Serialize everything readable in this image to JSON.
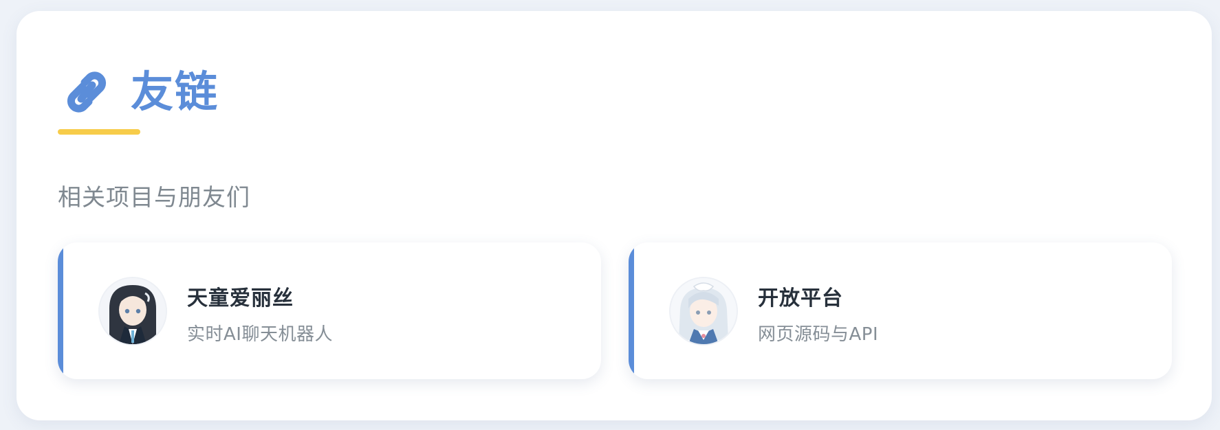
{
  "section": {
    "title": "友链",
    "title_icon": "link-icon",
    "subtitle": "相关项目与朋友们",
    "accent_color": "#5b8dd9",
    "underline_color": "#f7cc4a"
  },
  "links": [
    {
      "title": "天童爱丽丝",
      "description": "实时AI聊天机器人",
      "avatar_icon": "avatar-dark-hair-girl"
    },
    {
      "title": "开放平台",
      "description": "网页源码与API",
      "avatar_icon": "avatar-light-hair-girl"
    }
  ]
}
